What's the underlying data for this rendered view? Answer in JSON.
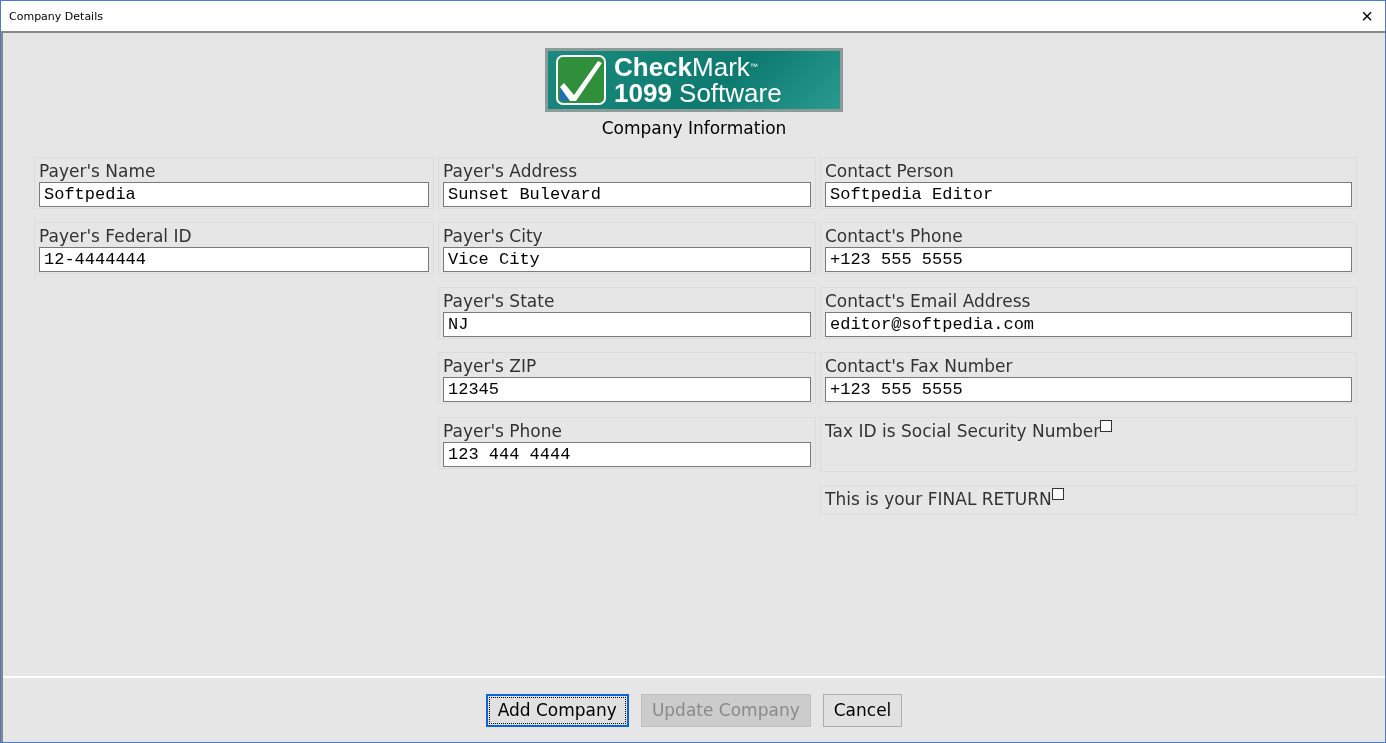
{
  "window": {
    "title": "Company Details",
    "close": "×"
  },
  "logo": {
    "line_1": "**Check**Mark$^{™}$",
    "line_2": "**1099** Software"
  },
  "heading": "Company Information",
  "columns": [
    {
      "fields": [
        {
          "kind": "text",
          "label": "Payer's Name",
          "value": "Softpedia"
        },
        {
          "kind": "text",
          "label": "Payer's Federal ID",
          "value": "12-4444444"
        }
      ]
    },
    {
      "fields": [
        {
          "kind": "text",
          "label": "Payer's Address",
          "value": "Sunset Bulevard"
        },
        {
          "kind": "text",
          "label": "Payer's City",
          "value": "Vice City"
        },
        {
          "kind": "text",
          "label": "Payer's State",
          "value": "NJ"
        },
        {
          "kind": "text",
          "label": "Payer's ZIP",
          "value": "12345"
        },
        {
          "kind": "text",
          "label": "Payer's Phone",
          "value": "123 444 4444"
        }
      ]
    },
    {
      "fields": [
        {
          "kind": "text",
          "label": "Contact Person",
          "value": "Softpedia Editor"
        },
        {
          "kind": "text",
          "label": "Contact's Phone",
          "value": "+123 555 5555"
        },
        {
          "kind": "text",
          "label": "Contact's Email Address",
          "value": "editor@softpedia.com"
        },
        {
          "kind": "text",
          "label": "Contact's Fax Number",
          "value": "+123 555 5555"
        },
        {
          "kind": "checkbox",
          "label": "Tax ID is Social Security Number",
          "checked": false,
          "tall": true
        },
        {
          "kind": "checkbox",
          "label": "This is your FINAL RETURN",
          "checked": false,
          "tall": false
        }
      ]
    }
  ],
  "buttons": [
    {
      "label": "Add Company",
      "default": true,
      "disabled": false
    },
    {
      "label": "Update Company",
      "default": false,
      "disabled": true
    },
    {
      "label": "Cancel",
      "default": false,
      "disabled": false
    }
  ]
}
